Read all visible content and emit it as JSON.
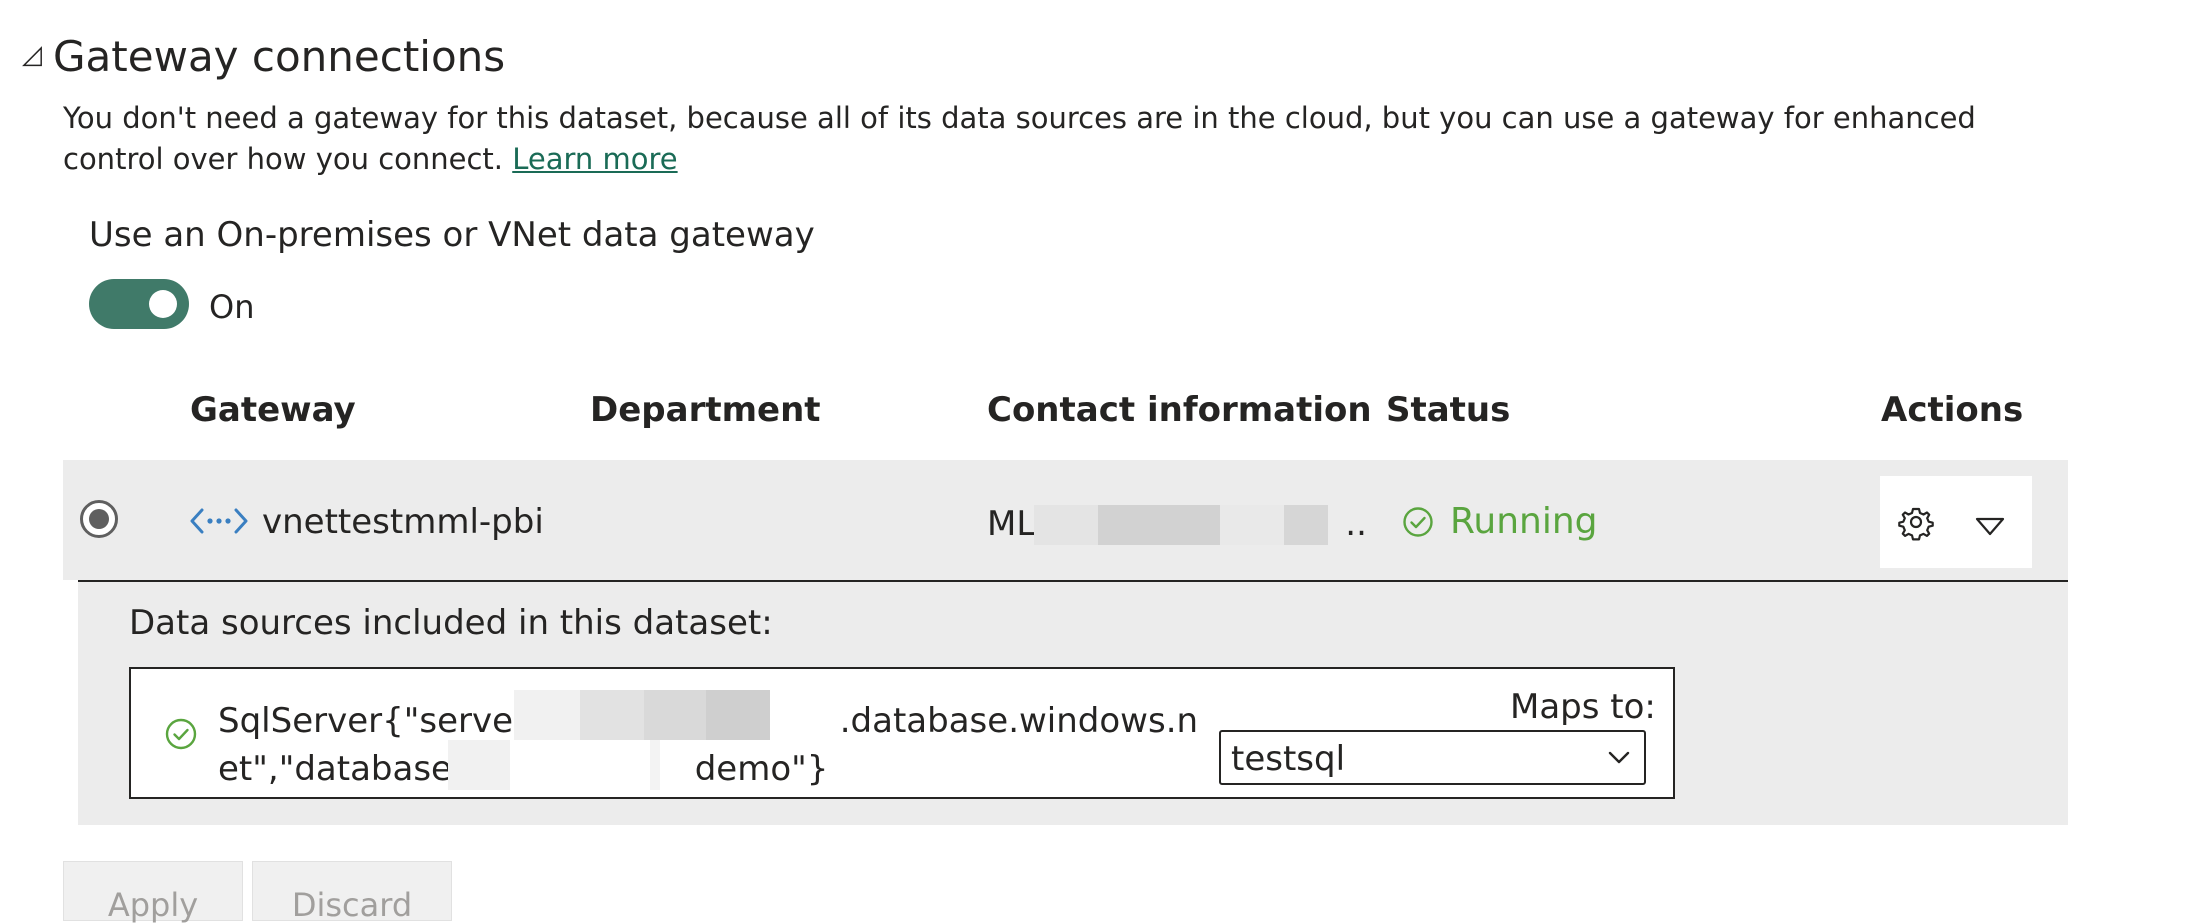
{
  "section": {
    "caret": "◿",
    "title": "Gateway connections",
    "description": "You don't need a gateway for this dataset, because all of its data sources are in the cloud, but you can use a gateway for enhanced control over how you connect.",
    "learn_more": "Learn more"
  },
  "toggle": {
    "label": "Use an On-premises or VNet data gateway",
    "state": "On",
    "on": true
  },
  "table": {
    "headers": {
      "gateway": "Gateway",
      "department": "Department",
      "contact": "Contact information",
      "status": "Status",
      "actions": "Actions"
    },
    "row": {
      "selected": true,
      "icon": "vnet-gateway-icon",
      "name": "vnettestmml-pbi",
      "department": "",
      "contact_prefix": "ML",
      "contact_suffix": "..",
      "status": "Running",
      "status_color": "#5aa53f"
    }
  },
  "datasources": {
    "title": "Data sources included in this dataset:",
    "line1_prefix": "SqlServer{\"server\":\"",
    "line1_suffix": ".database.windows.n",
    "line2_prefix": "et\",\"database\":\"",
    "line2_suffix": "demo\"}",
    "maps_to_label": "Maps to:",
    "maps_to_value": "testsql"
  },
  "buttons": {
    "apply": "Apply",
    "discard": "Discard"
  },
  "colors": {
    "accent": "#407a69",
    "link": "#1a6b56",
    "success": "#5aa53f",
    "row_bg": "#ececec"
  }
}
